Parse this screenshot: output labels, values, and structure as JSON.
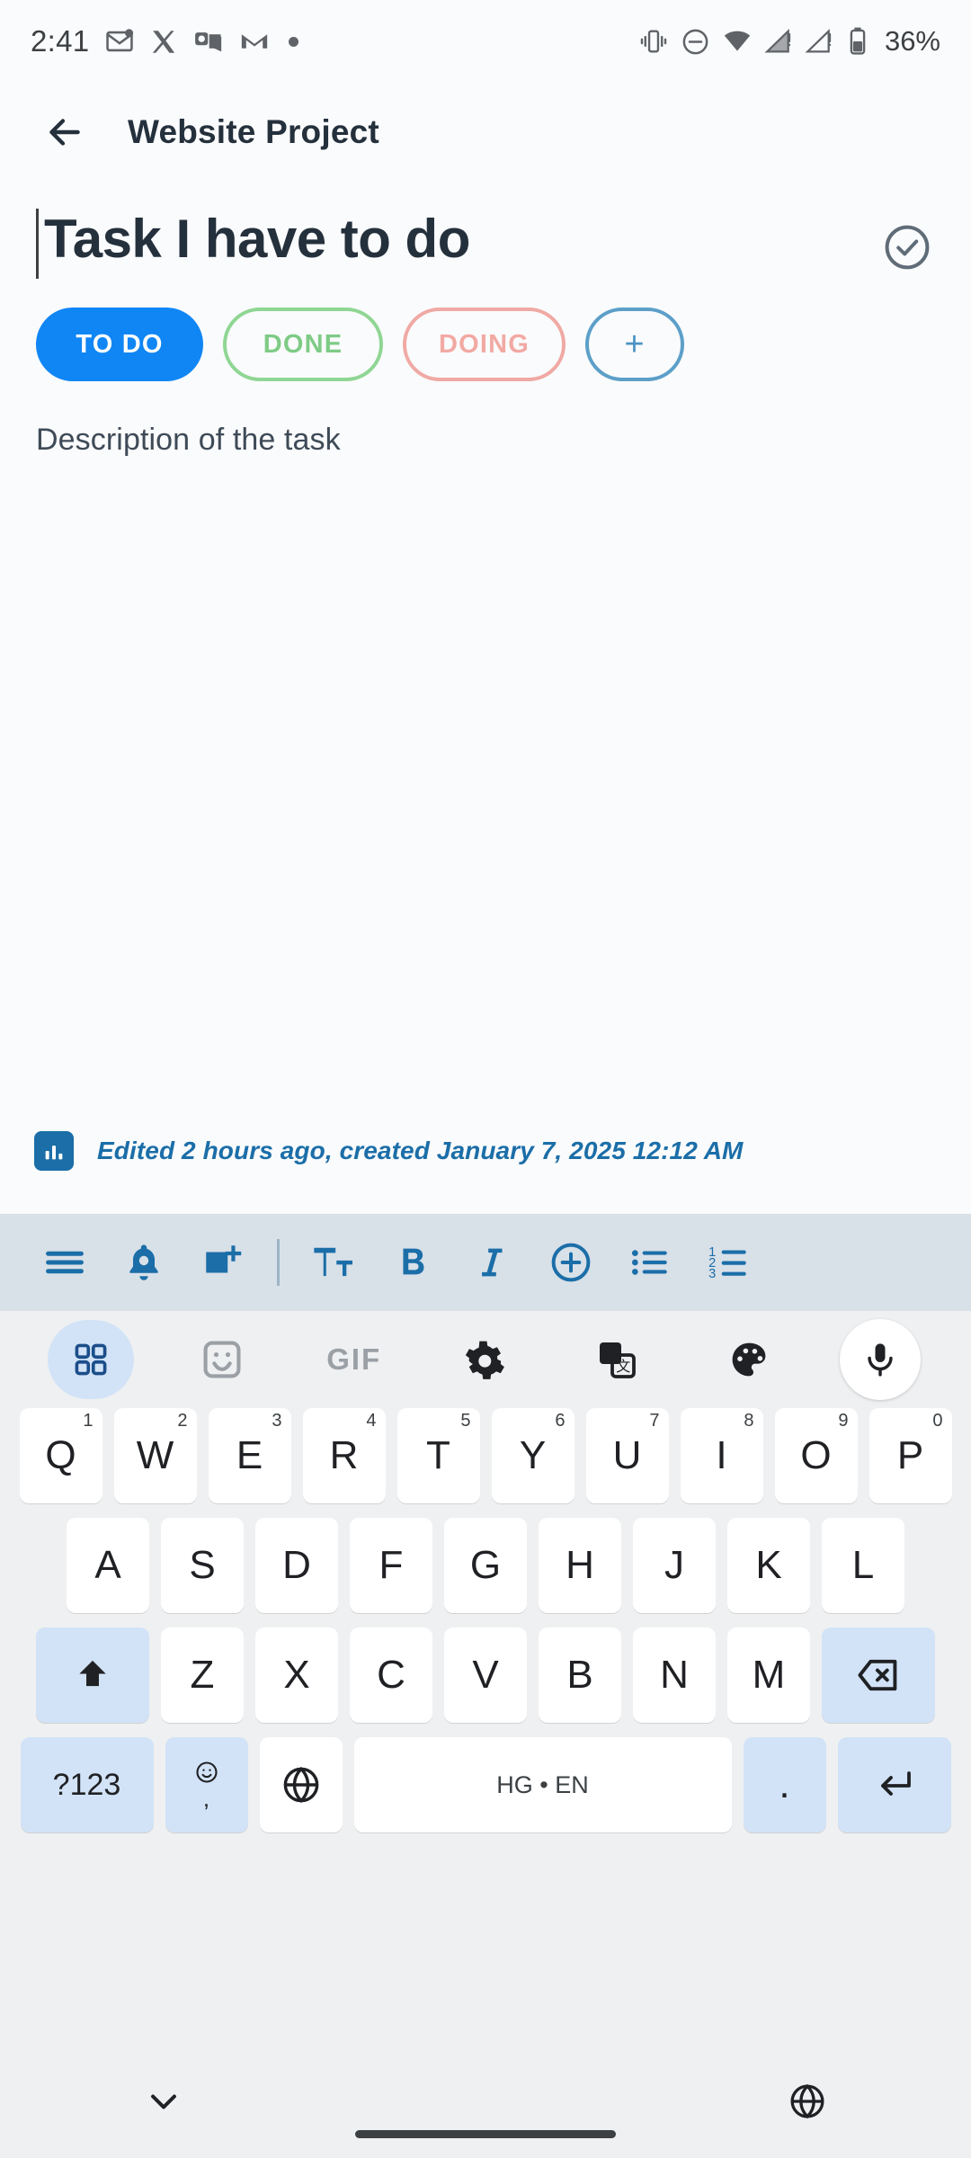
{
  "status_bar": {
    "time": "2:41",
    "battery_percent": "36%",
    "left_icons": [
      "mail-unread-icon",
      "x-twitter-icon",
      "outlook-icon",
      "gmail-icon",
      "dot-indicator-icon"
    ],
    "right_icons": [
      "vibrate-icon",
      "do-not-disturb-icon",
      "wifi-icon",
      "signal-sim1-icon",
      "signal-sim2-icon",
      "battery-icon"
    ]
  },
  "app_bar": {
    "back_label": "back-arrow",
    "title": "Website Project"
  },
  "task": {
    "title": "Task I have to do",
    "complete_toggle": "check-circle-icon",
    "description": "Description of the task",
    "chips": [
      {
        "label": "TO DO",
        "state": "selected",
        "color": "#1086f5"
      },
      {
        "label": "DONE",
        "state": "outline",
        "color": "#8fd694"
      },
      {
        "label": "DOING",
        "state": "outline",
        "color": "#f0a9a4"
      },
      {
        "label": "+",
        "state": "outline",
        "color": "#5c9fc9"
      }
    ]
  },
  "meta": {
    "icon": "stats-chart-icon",
    "text": "Edited 2 hours ago, created January 7, 2025 12:12 AM",
    "color": "#1b6ea8"
  },
  "editor_toolbar": {
    "background": "#d8e0e8",
    "accent": "#1b6ea8",
    "items": [
      {
        "name": "menu-lines-icon",
        "label": "☰"
      },
      {
        "name": "reminder-bell-icon",
        "label": "🔔"
      },
      {
        "name": "add-image-icon",
        "label": "🖼"
      },
      {
        "name": "divider",
        "label": ""
      },
      {
        "name": "text-format-icon",
        "label": "Tᴛ"
      },
      {
        "name": "bold-icon",
        "label": "B"
      },
      {
        "name": "italic-icon",
        "label": "I"
      },
      {
        "name": "add-circle-icon",
        "label": "⊕"
      },
      {
        "name": "bulleted-list-icon",
        "label": "☰"
      },
      {
        "name": "numbered-list-icon",
        "label": "1₃2₃3"
      }
    ]
  },
  "keyboard": {
    "suggestion_row": [
      {
        "name": "keyboard-grid-icon",
        "label": "grid",
        "highlighted": true
      },
      {
        "name": "sticker-icon",
        "label": "sticker",
        "highlighted": false
      },
      {
        "name": "gif-icon",
        "label": "GIF",
        "highlighted": false
      },
      {
        "name": "settings-gear-icon",
        "label": "gear",
        "highlighted": false
      },
      {
        "name": "google-translate-icon",
        "label": "translate",
        "highlighted": false
      },
      {
        "name": "theme-palette-icon",
        "label": "palette",
        "highlighted": false
      },
      {
        "name": "microphone-icon",
        "label": "mic",
        "highlighted": false
      }
    ],
    "row1": [
      {
        "key": "Q",
        "num": "1"
      },
      {
        "key": "W",
        "num": "2"
      },
      {
        "key": "E",
        "num": "3"
      },
      {
        "key": "R",
        "num": "4"
      },
      {
        "key": "T",
        "num": "5"
      },
      {
        "key": "Y",
        "num": "6"
      },
      {
        "key": "U",
        "num": "7"
      },
      {
        "key": "I",
        "num": "8"
      },
      {
        "key": "O",
        "num": "9"
      },
      {
        "key": "P",
        "num": "0"
      }
    ],
    "row2": [
      "A",
      "S",
      "D",
      "F",
      "G",
      "H",
      "J",
      "K",
      "L"
    ],
    "row3": {
      "shift": "shift-icon",
      "letters": [
        "Z",
        "X",
        "C",
        "V",
        "B",
        "N",
        "M"
      ],
      "backspace": "backspace-icon"
    },
    "row4": {
      "symbols": "?123",
      "emoji": "emoji-comma-key",
      "globe": "language-globe-icon",
      "space_label": "HG • EN",
      "period": ".",
      "enter": "enter-icon"
    }
  },
  "nav_bar": {
    "left": "collapse-keyboard-icon",
    "right": "language-globe-icon",
    "home_pill": "home-indicator"
  }
}
